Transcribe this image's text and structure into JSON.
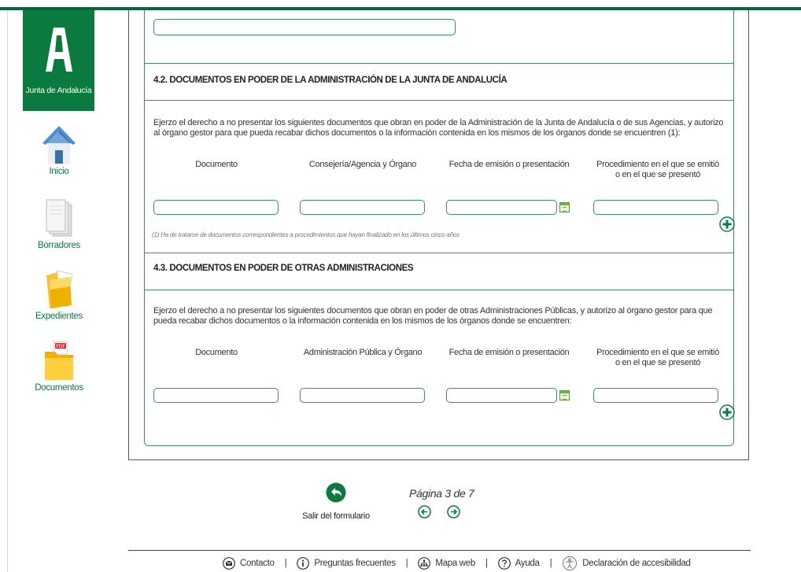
{
  "brand": {
    "name": "Junta de Andalucía",
    "color": "#0a7a3e"
  },
  "sidebar": {
    "items": [
      {
        "label": "Inicio",
        "icon": "home-icon"
      },
      {
        "label": "Borradores",
        "icon": "drafts-icon"
      },
      {
        "label": "Expedientes",
        "icon": "folder-icon"
      },
      {
        "label": "Documentos",
        "icon": "pdf-folder-icon"
      }
    ]
  },
  "sections": {
    "s42": {
      "title": "4.2. DOCUMENTOS EN PODER DE LA ADMINISTRACIÓN DE LA JUNTA DE ANDALUCÍA",
      "paragraph": "Ejerzo el derecho a no presentar los siguientes documentos que obran en poder de la Administración de la Junta de Andalucía o de sus Agencias, y autorizo al órgano gestor para que pueda recabar dichos documentos o la información contenida en los mismos de los órganos donde se encuentren (1):",
      "columns": [
        "Documento",
        "Consejería/Agencia y Órgano",
        "Fecha de emisión o presentación",
        "Procedimiento en el que se emitió o en el que se presentó"
      ],
      "values": [
        "",
        "",
        "",
        ""
      ],
      "note": "(1) Ha de tratarse de documentos correspondientes a procedimientos que hayan finalizado en los últimos cinco años"
    },
    "s43": {
      "title": "4.3. DOCUMENTOS EN PODER DE OTRAS ADMINISTRACIONES",
      "paragraph": "Ejerzo el derecho a no presentar los siguientes documentos que obran en poder de otras Administraciones Públicas, y autorizo al órgano gestor para que pueda recabar dichos documentos o la información contenida en los mismos de los órganos donde se encuentren:",
      "columns": [
        "Documento",
        "Administración Pública y Órgano",
        "Fecha de emisión o presentación",
        "Procedimiento en el que se emitió o en el que se presentó"
      ],
      "values": [
        "",
        "",
        "",
        ""
      ]
    }
  },
  "navigation": {
    "exit_label": "Salir del formulario",
    "page_label": "Página 3 de 7"
  },
  "footer": {
    "items": [
      {
        "label": "Contacto",
        "icon": "mail-icon"
      },
      {
        "label": "Preguntas frecuentes",
        "icon": "info-icon"
      },
      {
        "label": "Mapa web",
        "icon": "sitemap-icon"
      },
      {
        "label": "Ayuda",
        "icon": "help-icon"
      },
      {
        "label": "Declaración de accesibilidad",
        "icon": "accessibility-icon"
      }
    ]
  }
}
